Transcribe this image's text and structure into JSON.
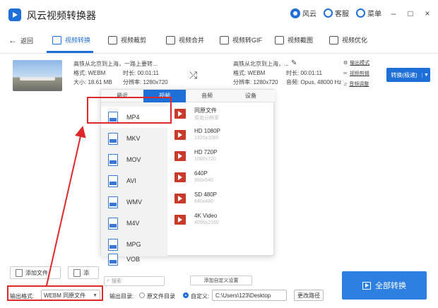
{
  "app": {
    "title": "风云视频转换器"
  },
  "titlebar": {
    "user": "风云",
    "service": "客服",
    "menu": "菜单",
    "minimize": "–",
    "maximize": "□",
    "close": "×"
  },
  "toolbar": {
    "back": "返回",
    "tools": [
      "视频转换",
      "视频裁剪",
      "视频合并",
      "视频转GIF",
      "视频截图",
      "视频优化"
    ]
  },
  "file": {
    "src_name": "高铁从北京到上海，一路上要转...",
    "src_format": "格式: WEBM",
    "src_duration": "时长: 00:01:11",
    "src_size": "大小: 18.61 MB",
    "src_resolution": "分辨率: 1280x720",
    "dst_name": "高铁从北京到上海，...",
    "dst_format": "格式: WEBM",
    "dst_duration": "时长: 00:01:11",
    "dst_resolution": "分辨率: 1280x720",
    "dst_audio": "音频: Opus, 48000 Hz",
    "links": [
      "输出模式",
      "视频剪辑",
      "音频调整"
    ],
    "convert_label": "转换(极速)"
  },
  "popup": {
    "tabs": [
      "最近",
      "视频",
      "音频",
      "设备"
    ],
    "formats": [
      "MP4",
      "MKV",
      "MOV",
      "AVI",
      "WMV",
      "M4V",
      "MPG",
      "VOB"
    ],
    "qualities": [
      {
        "title": "同原文件",
        "sub": "原始分辨率"
      },
      {
        "title": "HD 1080P",
        "sub": "1920x1080"
      },
      {
        "title": "HD 720P",
        "sub": "1080x720"
      },
      {
        "title": "640P",
        "sub": "960x640"
      },
      {
        "title": "SD 480P",
        "sub": "640x480"
      },
      {
        "title": "4K Video",
        "sub": "4096x2160"
      }
    ],
    "search_placeholder": "搜索",
    "custom_label": "添加自定义设置"
  },
  "bottom": {
    "add_file": "添加文件",
    "add_folder": "添",
    "output_format_label": "输出格式:",
    "output_format_value": "WEBM 同原文件",
    "output_dir_label": "输出目录:",
    "radio_source": "原文件目录",
    "radio_custom": "自定义:",
    "path": "C:\\Users\\123\\Desktop",
    "change_path": "更改路径",
    "convert_all": "全部转换"
  },
  "colors": {
    "accent": "#1f6fd8",
    "annotation": "#e0282a"
  }
}
